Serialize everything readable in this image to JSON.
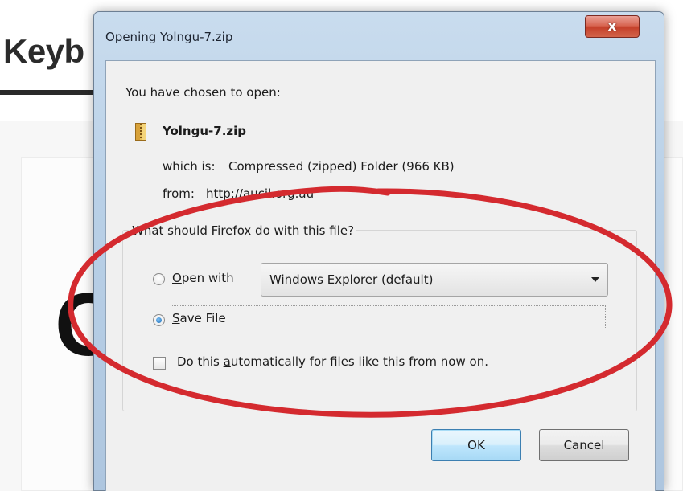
{
  "background_page": {
    "heading": "Keyb",
    "big_letter": "C"
  },
  "dialog": {
    "title": "Opening Yolngu-7.zip",
    "close_glyph": "x",
    "chosen_text": "You have chosen to open:",
    "file_icon": "zip-folder-icon",
    "file_name": "Yolngu-7.zip",
    "which_label": "which is:",
    "which_value": "Compressed (zipped) Folder (966 KB)",
    "from_label": "from:",
    "from_value": "http://aucil.org.au",
    "question": "What should Firefox do with this file?",
    "open_with": {
      "label_prefix": "",
      "label_access": "O",
      "label_rest": "pen with",
      "selected": false,
      "select_value": "Windows Explorer (default)"
    },
    "save_file": {
      "label_access": "S",
      "label_rest": "ave File",
      "selected": true
    },
    "auto": {
      "label_pre": "Do this ",
      "label_access": "a",
      "label_rest": "utomatically for files like this from now on.",
      "checked": false
    },
    "ok_label": "OK",
    "cancel_label": "Cancel"
  },
  "colors": {
    "annotation_ellipse": "#d42a2f",
    "title_close": "#c5412b",
    "ok_border": "#3c7fb1"
  }
}
